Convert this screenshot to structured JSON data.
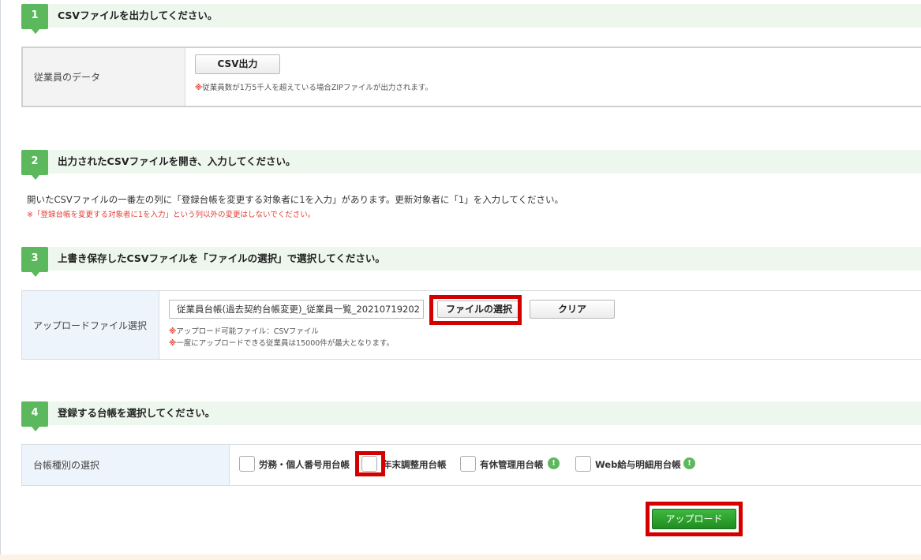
{
  "steps": [
    {
      "num": "1",
      "title": "CSVファイルを出力してください。"
    },
    {
      "num": "2",
      "title": "出力されたCSVファイルを開き、入力してください。"
    },
    {
      "num": "3",
      "title": "上書き保存したCSVファイルを「ファイルの選択」で選択してください。"
    },
    {
      "num": "4",
      "title": "登録する台帳を選択してください。"
    }
  ],
  "export": {
    "label": "従業員のデータ",
    "button": "CSV出力",
    "note_mark": "※",
    "note": "従業員数が1万5千人を超えている場合ZIPファイルが出力されます。"
  },
  "instructions": {
    "text": "開いたCSVファイルの一番左の列に「登録台帳を変更する対象者に1を入力」があります。更新対象者に「1」を入力してください。",
    "warning": "※「登録台帳を変更する対象者に1を入力」という列以外の変更はしないでください。"
  },
  "upload": {
    "label": "アップロードファイル選択",
    "filename": "従業員台帳(過去契約台帳変更)_従業員一覧_20210719202",
    "choose_button": "ファイルの選択",
    "clear_button": "クリア",
    "note_mark": "※",
    "note1": "アップロード可能ファイル：CSVファイル",
    "note2": "一度にアップロードできる従業員は15000件が最大となります。"
  },
  "ledger": {
    "label": "台帳種別の選択",
    "options": [
      {
        "label": "労務・個人番号用台帳",
        "checked": false
      },
      {
        "label": "年末調整用台帳",
        "checked": false
      },
      {
        "label": "有休管理用台帳",
        "checked": false,
        "info_icon": "exclamation-icon"
      },
      {
        "label": "Web給与明細用台帳",
        "checked": false,
        "info_icon": "exclamation-icon"
      }
    ],
    "info_glyph": "!"
  },
  "submit": {
    "label": "アップロード"
  },
  "colors": {
    "accent_green": "#5cb85c",
    "highlight_red": "#d40000",
    "upload_button": "#2e9e2e"
  }
}
